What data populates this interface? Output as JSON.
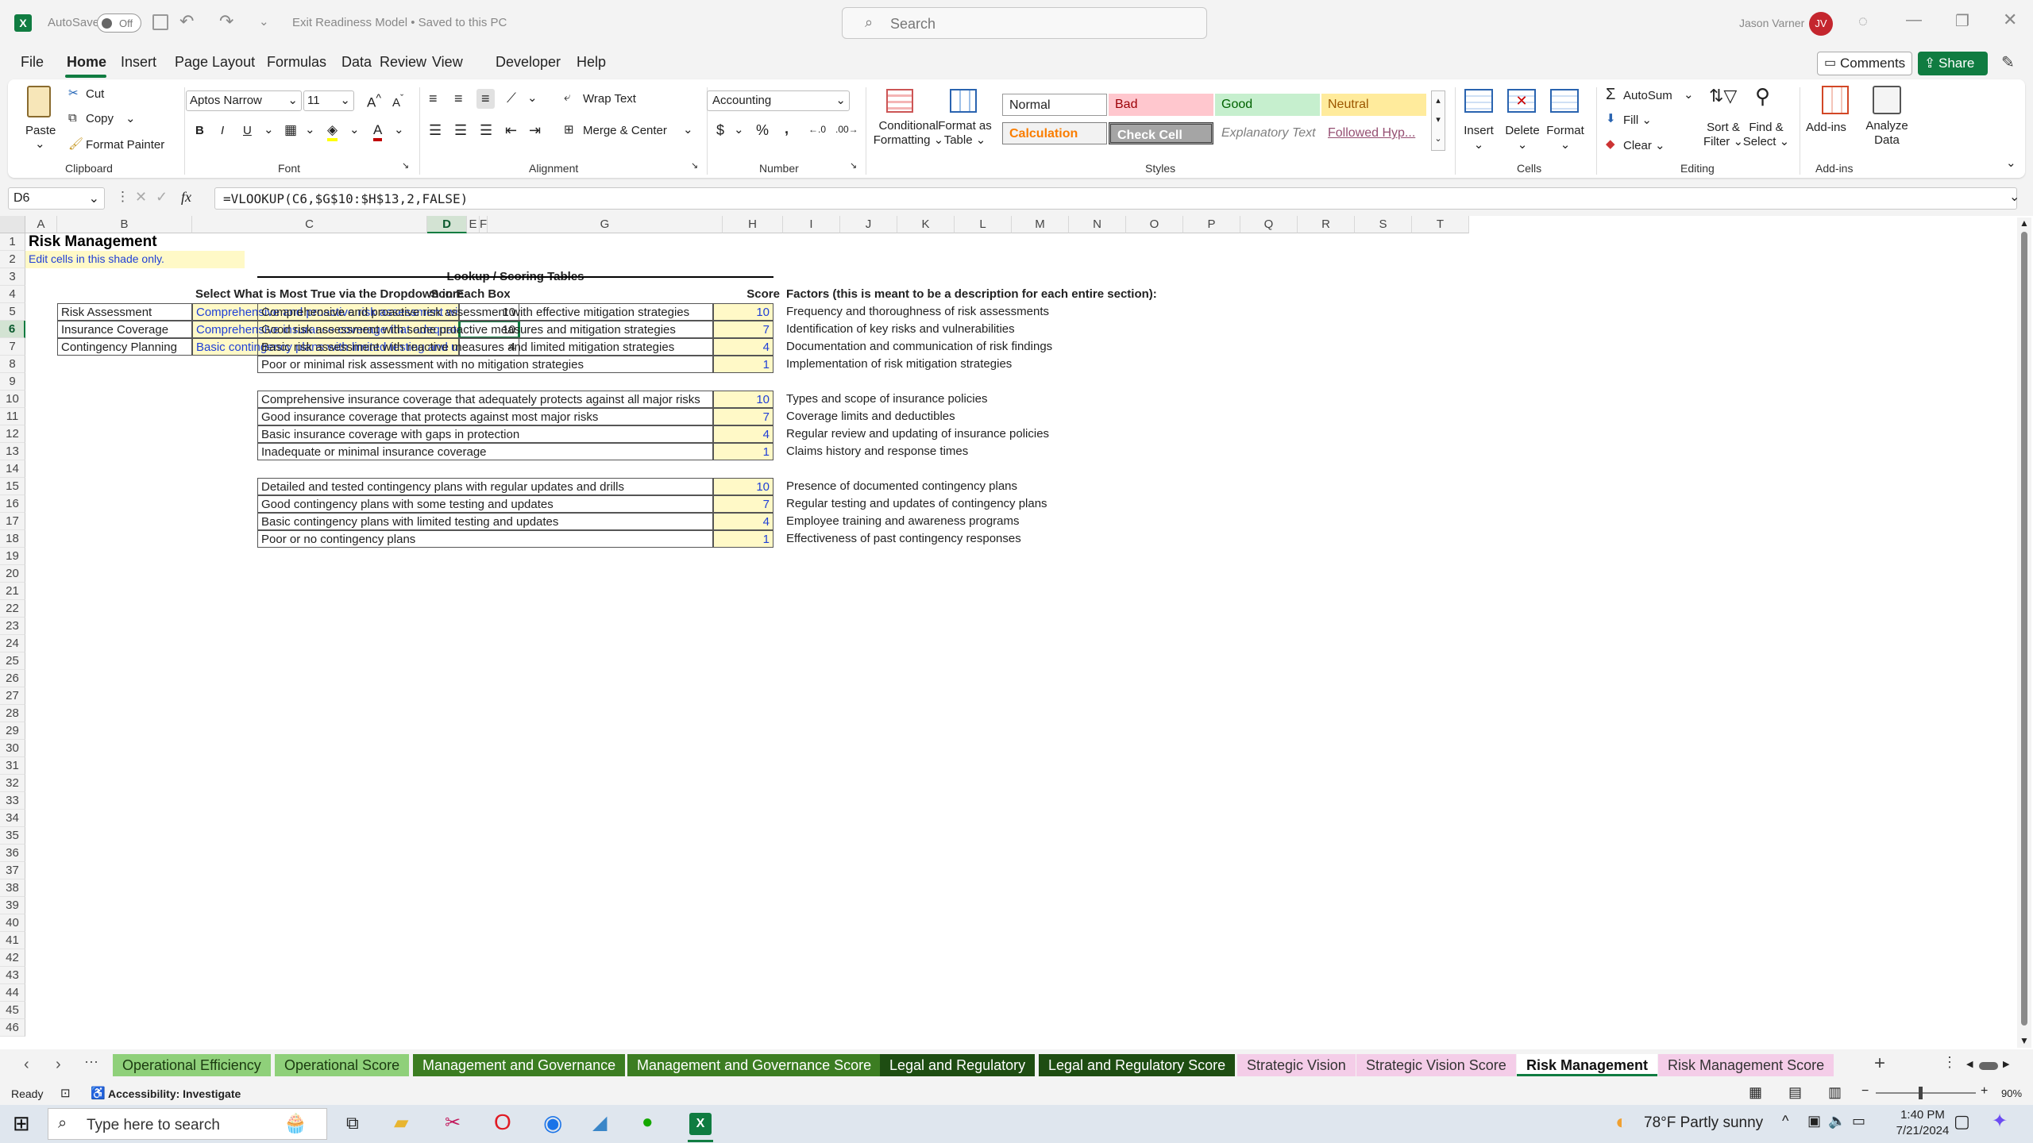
{
  "titlebar": {
    "autosave_label": "AutoSave",
    "autosave_state": "Off",
    "doc_title": "Exit Readiness Model • Saved to this PC",
    "search_placeholder": "Search",
    "user_name": "Jason Varner",
    "user_initials": "JV"
  },
  "menu": [
    "File",
    "Home",
    "Insert",
    "Page Layout",
    "Formulas",
    "Data",
    "Review",
    "View",
    "Developer",
    "Help"
  ],
  "menu_right": {
    "comments": "Comments",
    "share": "Share"
  },
  "ribbon": {
    "clipboard": {
      "paste": "Paste",
      "cut": "Cut",
      "copy": "Copy",
      "format_painter": "Format Painter",
      "label": "Clipboard"
    },
    "font": {
      "name": "Aptos Narrow",
      "size": "11",
      "label": "Font"
    },
    "alignment": {
      "wrap": "Wrap Text",
      "merge": "Merge & Center",
      "label": "Alignment"
    },
    "number": {
      "format": "Accounting",
      "label": "Number"
    },
    "styles": {
      "conditional": [
        "Conditional",
        "Formatting"
      ],
      "format_table": [
        "Format as",
        "Table"
      ],
      "cells": [
        "Normal",
        "Bad",
        "Good",
        "Neutral",
        "Calculation",
        "Check Cell",
        "Explanatory Text",
        "Followed Hyp..."
      ],
      "label": "Styles"
    },
    "cells": {
      "insert": "Insert",
      "delete": "Delete",
      "format": "Format",
      "label": "Cells"
    },
    "editing": {
      "autosum": "AutoSum",
      "fill": "Fill",
      "clear": "Clear",
      "sort": [
        "Sort &",
        "Filter"
      ],
      "find": [
        "Find &",
        "Select"
      ],
      "label": "Editing"
    },
    "addins": {
      "addins": "Add-ins",
      "analyze": [
        "Analyze",
        "Data"
      ],
      "label": "Add-ins"
    }
  },
  "formula_bar": {
    "name_box": "D6",
    "fx": "fx",
    "formula": "=VLOOKUP(C6,$G$10:$H$13,2,FALSE)"
  },
  "columns": [
    "A",
    "B",
    "C",
    "D",
    "E",
    "F",
    "G",
    "H",
    "I",
    "J",
    "K",
    "L",
    "M",
    "N",
    "O",
    "P",
    "Q",
    "R",
    "S",
    "T"
  ],
  "rows": [
    "1",
    "2",
    "3",
    "4",
    "5",
    "6",
    "7",
    "8",
    "9",
    "10",
    "11",
    "12",
    "13",
    "14",
    "15",
    "16",
    "17",
    "18",
    "19",
    "20",
    "21",
    "22",
    "23",
    "24",
    "25",
    "26",
    "27",
    "28",
    "29",
    "30",
    "31",
    "32",
    "33",
    "34",
    "35",
    "36",
    "37",
    "38",
    "39",
    "40",
    "41",
    "42",
    "43",
    "44",
    "45",
    "46"
  ],
  "sheet": {
    "title": "Risk Management",
    "note": "Edit cells in this shade only.",
    "select_header": "Select What is Most True via the Dropdown in Each Box",
    "score_header": "Score",
    "inputs": [
      {
        "label": "Risk Assessment",
        "choice": "Comprehensive and proactive risk assessment with effective mitigation strategies",
        "score": "10"
      },
      {
        "label": "Insurance Coverage",
        "choice": "Comprehensive insurance coverage that adequately protects against all major risks",
        "score": "10"
      },
      {
        "label": "Contingency Planning",
        "choice": "Basic contingency plans with limited testing and updates",
        "score": "4"
      }
    ],
    "lookup_title": "Lookup  / Scoring Tables",
    "lookup_score_header": "Score",
    "factors_header": "Factors (this is meant to be a description for each entire section):",
    "lookup_groups": [
      [
        {
          "text": "Comprehensive and proactive risk assessment with effective mitigation strategies",
          "score": "10",
          "factor": "Frequency and thoroughness of risk assessments"
        },
        {
          "text": "Good risk assessment with some proactive measures and mitigation strategies",
          "score": "7",
          "factor": "Identification of key risks and vulnerabilities"
        },
        {
          "text": "Basic risk assessment with reactive measures and limited mitigation strategies",
          "score": "4",
          "factor": "Documentation and communication of risk findings"
        },
        {
          "text": "Poor or minimal risk assessment with no mitigation strategies",
          "score": "1",
          "factor": "Implementation of risk mitigation strategies"
        }
      ],
      [
        {
          "text": "Comprehensive insurance coverage that adequately protects against all major risks",
          "score": "10",
          "factor": "Types and scope of insurance policies"
        },
        {
          "text": "Good insurance coverage that protects against most major risks",
          "score": "7",
          "factor": "Coverage limits and deductibles"
        },
        {
          "text": "Basic insurance coverage with gaps in protection",
          "score": "4",
          "factor": "Regular review and updating of insurance policies"
        },
        {
          "text": "Inadequate or minimal insurance coverage",
          "score": "1",
          "factor": "Claims history and response times"
        }
      ],
      [
        {
          "text": "Detailed and tested contingency plans with regular updates and drills",
          "score": "10",
          "factor": "Presence of documented contingency plans"
        },
        {
          "text": "Good contingency plans with some testing and updates",
          "score": "7",
          "factor": "Regular testing and updates of contingency plans"
        },
        {
          "text": "Basic contingency plans with limited testing and updates",
          "score": "4",
          "factor": "Employee training and awareness programs"
        },
        {
          "text": "Poor or no contingency plans",
          "score": "1",
          "factor": "Effectiveness of past contingency responses"
        }
      ]
    ]
  },
  "sheet_tabs": [
    {
      "label": "Operational Efficiency",
      "bg": "#8fd07a",
      "fg": "#1b3a10"
    },
    {
      "label": "Operational Score",
      "bg": "#8fd07a",
      "fg": "#1b3a10"
    },
    {
      "label": "Management and Governance",
      "bg": "#3c7d22",
      "fg": "#ffffff"
    },
    {
      "label": "Management and Governance Score",
      "bg": "#3c7d22",
      "fg": "#ffffff"
    },
    {
      "label": "Legal and Regulatory",
      "bg": "#1e4d12",
      "fg": "#ffffff"
    },
    {
      "label": "Legal and Regulatory Score",
      "bg": "#1e4d12",
      "fg": "#ffffff"
    },
    {
      "label": "Strategic Vision",
      "bg": "#f4cde8",
      "fg": "#333333"
    },
    {
      "label": "Strategic Vision Score",
      "bg": "#f4cde8",
      "fg": "#333333"
    },
    {
      "label": "Risk Management",
      "bg": "#ffffff",
      "fg": "#111111"
    },
    {
      "label": "Risk Management Score",
      "bg": "#f4cde8",
      "fg": "#333333"
    }
  ],
  "status": {
    "ready": "Ready",
    "accessibility": "Accessibility: Investigate",
    "zoom": "90%"
  },
  "taskbar": {
    "search": "Type here to search",
    "weather": "78°F  Partly sunny",
    "time": "1:40 PM",
    "date": "7/21/2024"
  }
}
